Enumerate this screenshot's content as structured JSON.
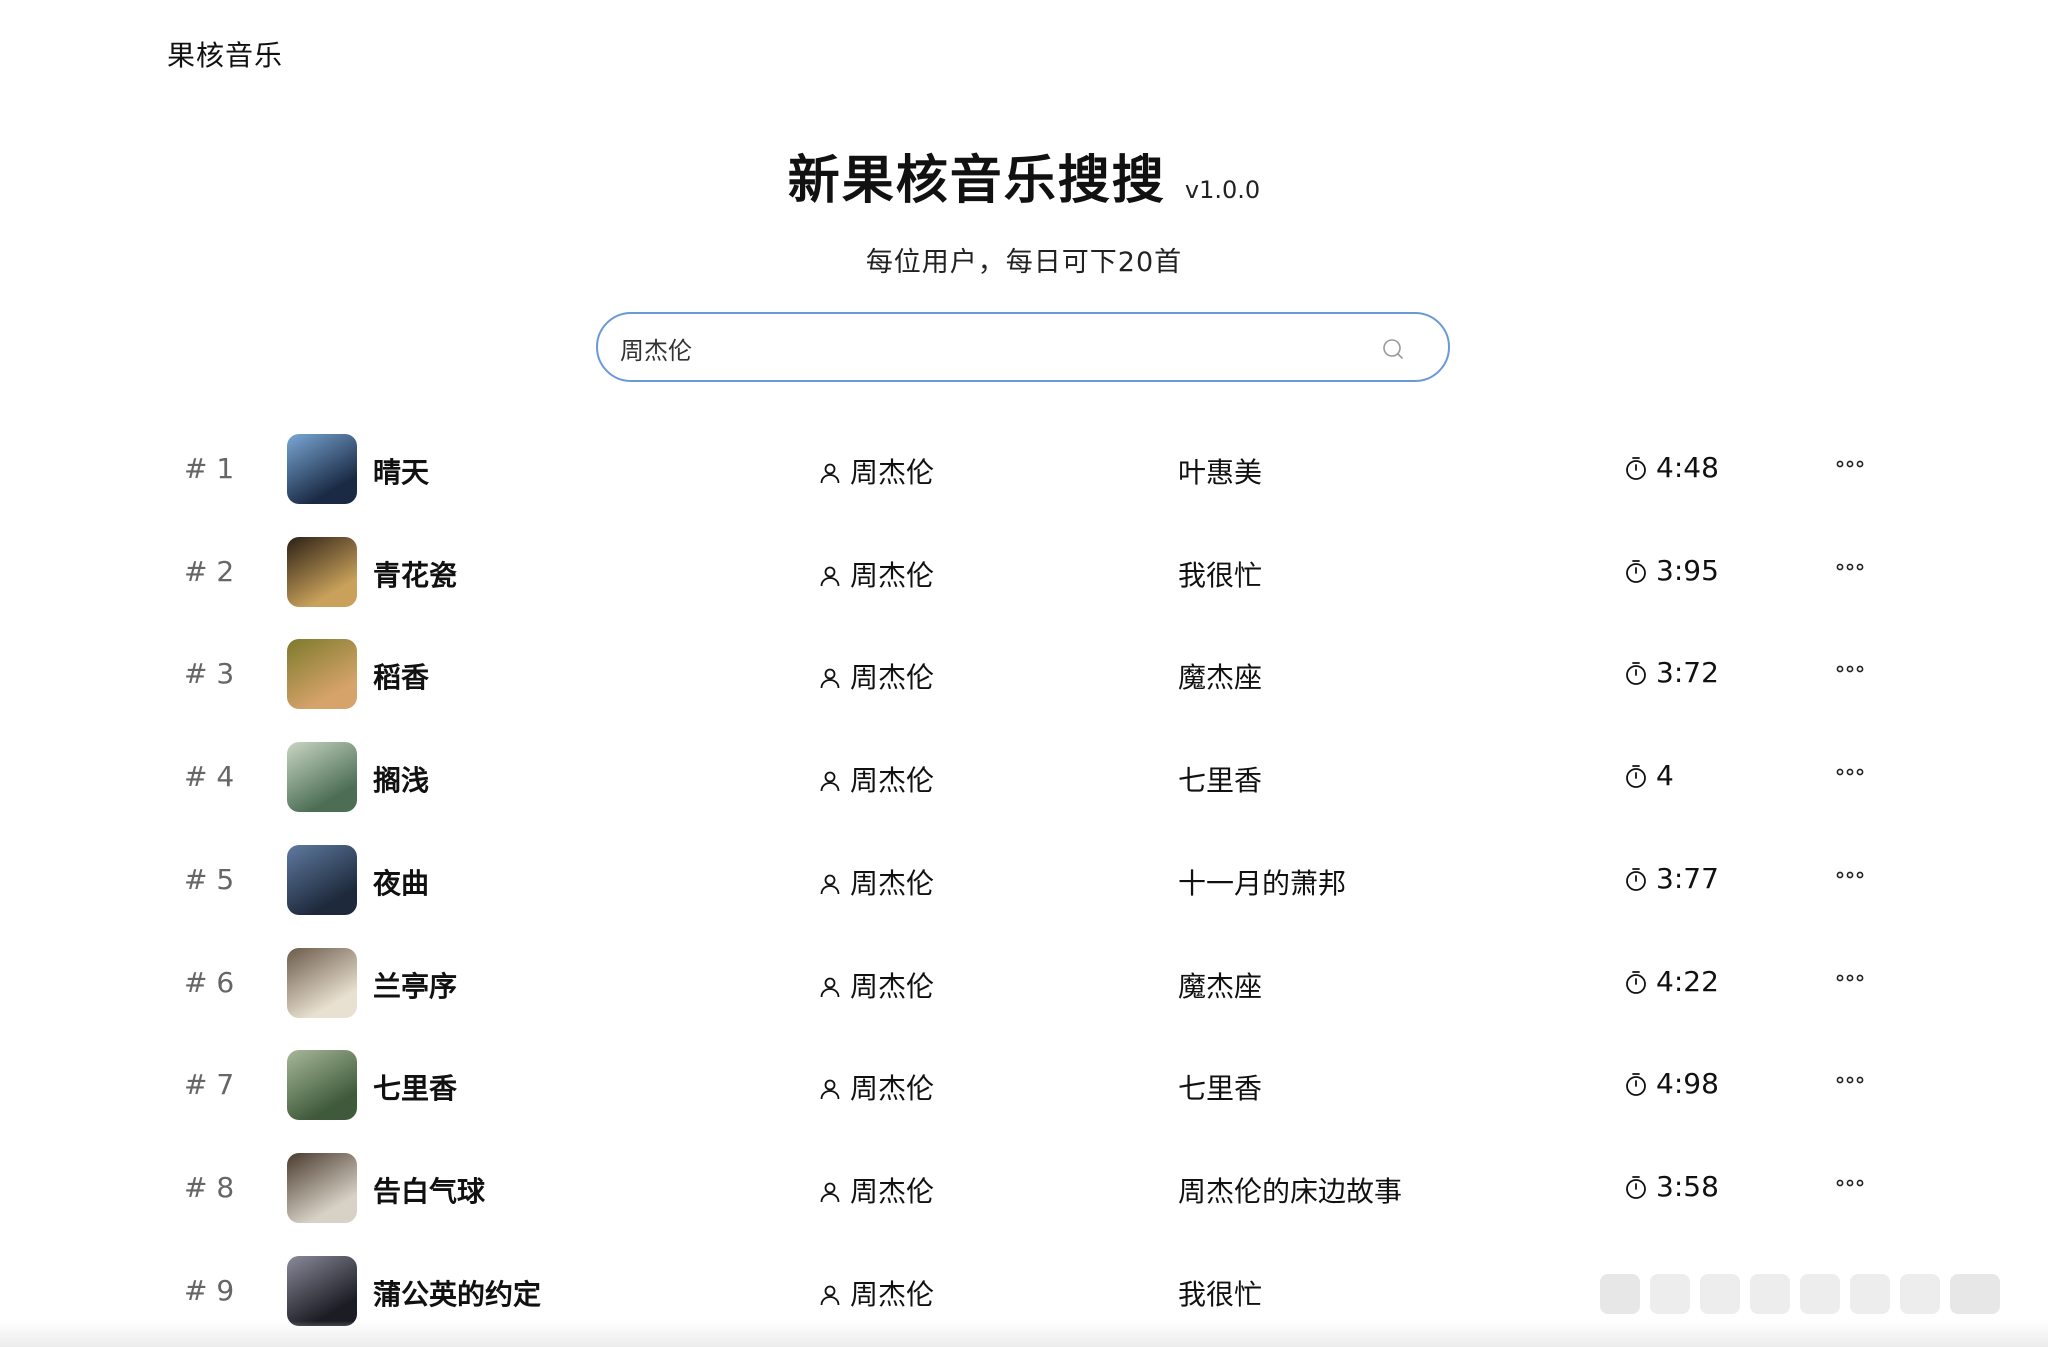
{
  "app": {
    "brand": "果核音乐"
  },
  "header": {
    "title": "新果核音乐搜搜",
    "version": "v1.0.0",
    "subtitle": "每位用户，每日可下20首"
  },
  "search": {
    "value": "周杰伦",
    "placeholder": "周杰伦",
    "icon": "search-icon"
  },
  "songs": [
    {
      "rank": "# 1",
      "title": "晴天",
      "artist": "周杰伦",
      "album": "叶惠美",
      "duration": "4:48",
      "cover_colors": [
        "#1a2a44",
        "#7aa8d6"
      ]
    },
    {
      "rank": "# 2",
      "title": "青花瓷",
      "artist": "周杰伦",
      "album": "我很忙",
      "duration": "3:95",
      "cover_colors": [
        "#c9a15a",
        "#2b2016"
      ]
    },
    {
      "rank": "# 3",
      "title": "稻香",
      "artist": "周杰伦",
      "album": "魔杰座",
      "duration": "3:72",
      "cover_colors": [
        "#d6a36a",
        "#7d7a2c"
      ]
    },
    {
      "rank": "# 4",
      "title": "搁浅",
      "artist": "周杰伦",
      "album": "七里香",
      "duration": "4",
      "cover_colors": [
        "#4d6e55",
        "#c9d6c4"
      ]
    },
    {
      "rank": "# 5",
      "title": "夜曲",
      "artist": "周杰伦",
      "album": "十一月的萧邦",
      "duration": "3:77",
      "cover_colors": [
        "#1e2a3c",
        "#5f7aa0"
      ]
    },
    {
      "rank": "# 6",
      "title": "兰亭序",
      "artist": "周杰伦",
      "album": "魔杰座",
      "duration": "4:22",
      "cover_colors": [
        "#e8e0d0",
        "#6b5a4a"
      ]
    },
    {
      "rank": "# 7",
      "title": "七里香",
      "artist": "周杰伦",
      "album": "七里香",
      "duration": "4:98",
      "cover_colors": [
        "#3e5a3a",
        "#a8b89a"
      ]
    },
    {
      "rank": "# 8",
      "title": "告白气球",
      "artist": "周杰伦",
      "album": "周杰伦的床边故事",
      "duration": "3:58",
      "cover_colors": [
        "#d8d2c6",
        "#4a3a2e"
      ]
    },
    {
      "rank": "# 9",
      "title": "蒲公英的约定",
      "artist": "周杰伦",
      "album": "我很忙",
      "duration": "",
      "cover_colors": [
        "#1c1c24",
        "#8a8a9a"
      ]
    }
  ],
  "colors": {
    "search_border": "#6a99d8",
    "rank": "#666666",
    "text": "#111111"
  }
}
